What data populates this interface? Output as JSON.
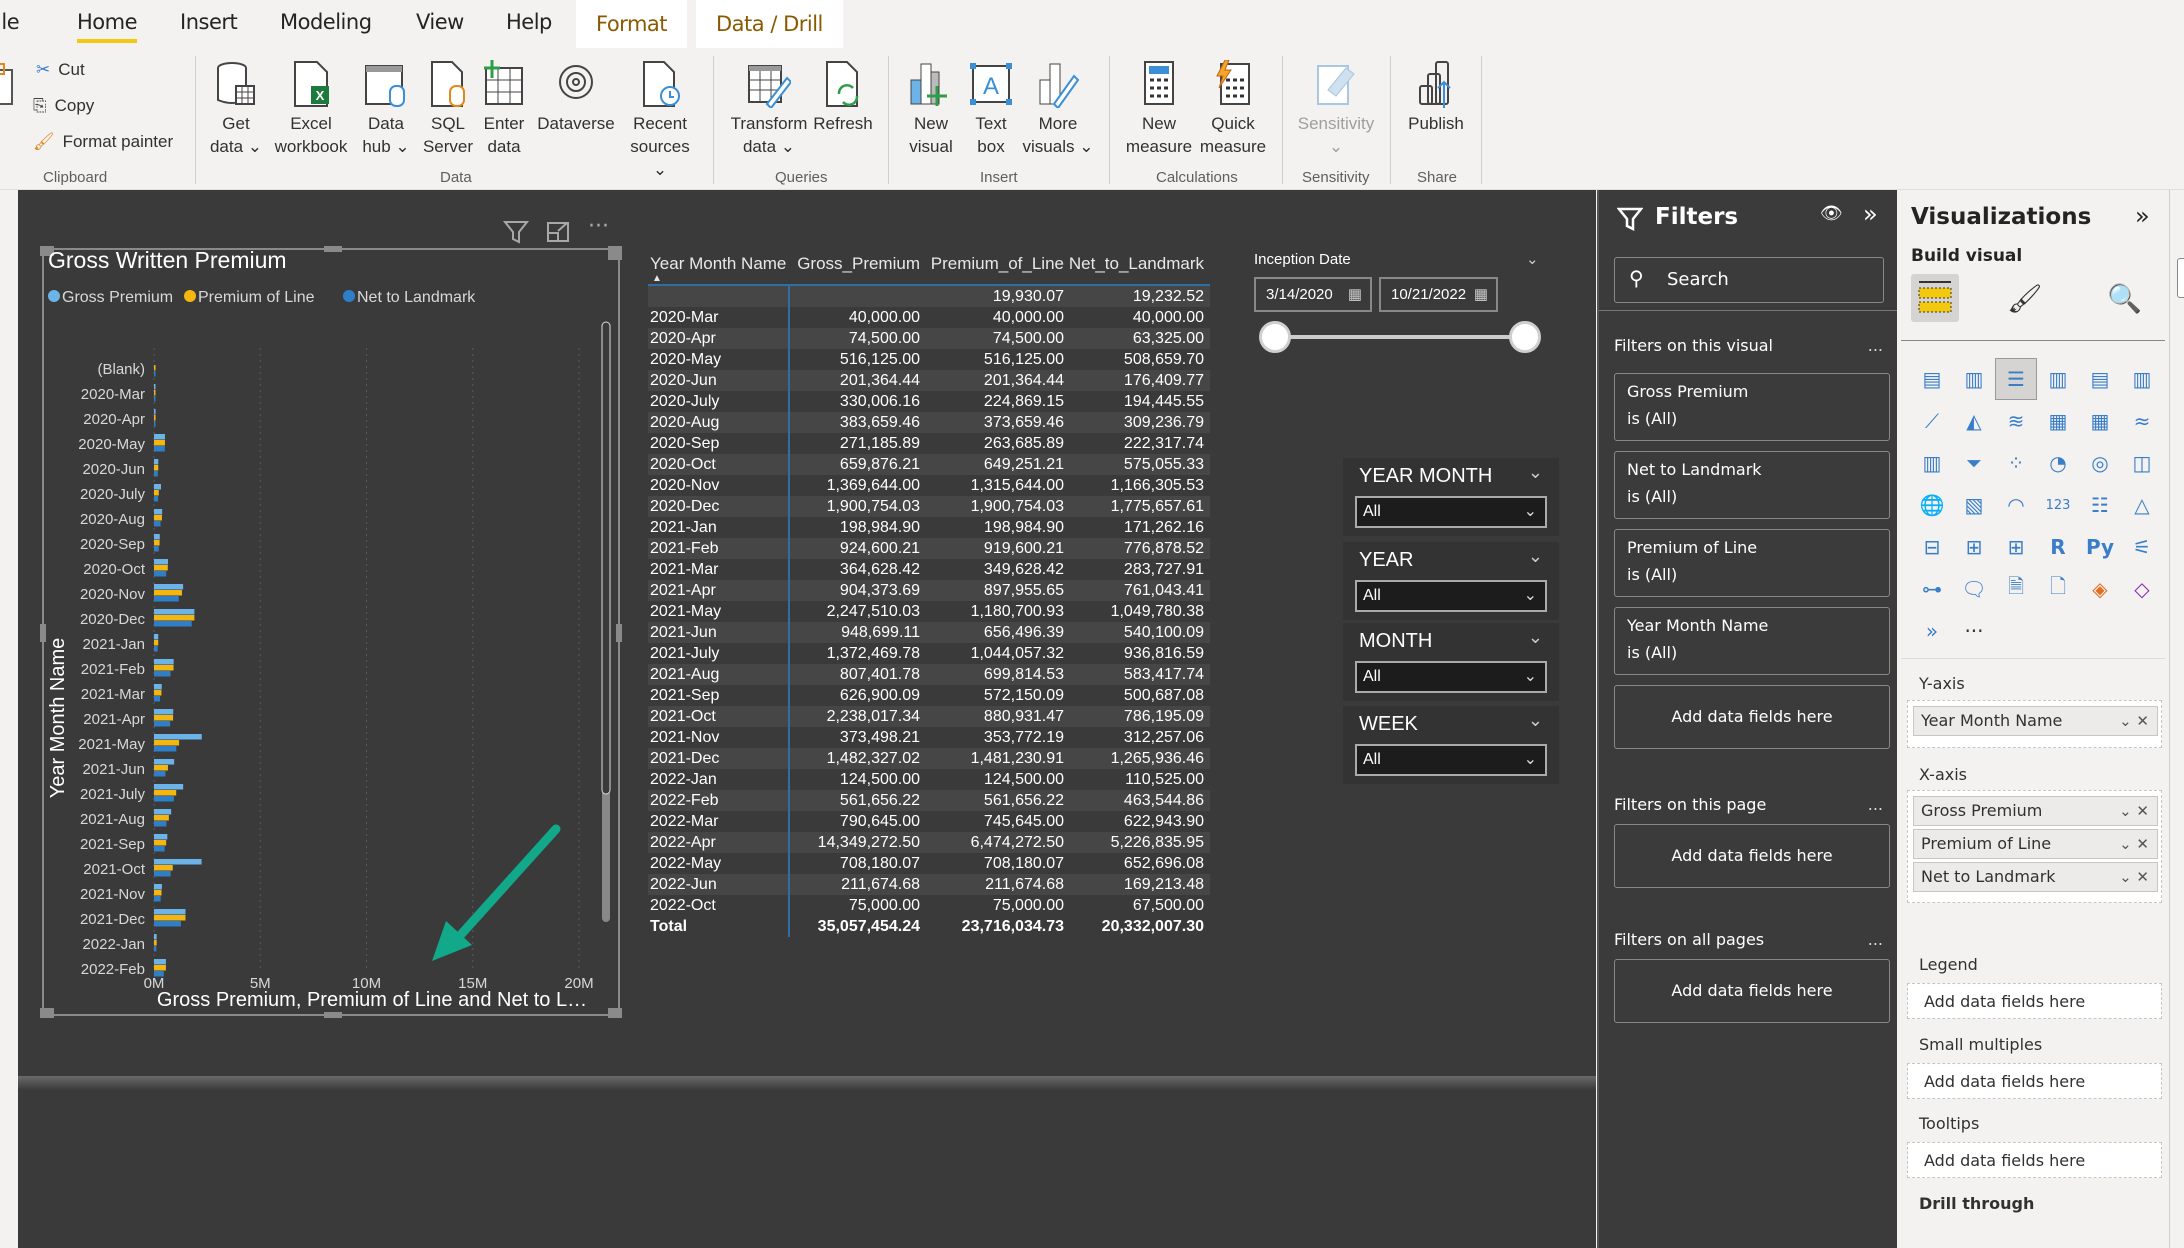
{
  "tabs": [
    {
      "label": "File"
    },
    {
      "label": "Home",
      "active": true
    },
    {
      "label": "Insert"
    },
    {
      "label": "Modeling"
    },
    {
      "label": "View"
    },
    {
      "label": "Help"
    },
    {
      "label": "Format",
      "contextual": true
    },
    {
      "label": "Data / Drill",
      "contextual": true
    }
  ],
  "ribbon": {
    "clipboard": {
      "paste": "Paste",
      "cut": "Cut",
      "copy": "Copy",
      "format_painter": "Format painter",
      "label": "Clipboard"
    },
    "data": {
      "label": "Data",
      "buttons": [
        {
          "l1": "Get",
          "l2": "data",
          "dropdown": true,
          "icon": "database-icon"
        },
        {
          "l1": "Excel",
          "l2": "workbook",
          "icon": "excel-icon"
        },
        {
          "l1": "Data",
          "l2": "hub",
          "dropdown": true,
          "icon": "data-hub-icon"
        },
        {
          "l1": "SQL",
          "l2": "Server",
          "icon": "sql-server-icon"
        },
        {
          "l1": "Enter",
          "l2": "data",
          "icon": "enter-data-icon"
        },
        {
          "l1": "Dataverse",
          "l2": "",
          "icon": "dataverse-icon"
        },
        {
          "l1": "Recent",
          "l2": "sources",
          "dropdown": true,
          "icon": "recent-sources-icon"
        }
      ]
    },
    "queries": {
      "label": "Queries",
      "transform_l1": "Transform",
      "transform_l2": "data",
      "refresh": "Refresh"
    },
    "insert": {
      "label": "Insert",
      "new_visual_l1": "New",
      "new_visual_l2": "visual",
      "text_box_l1": "Text",
      "text_box_l2": "box",
      "more_visuals_l1": "More",
      "more_visuals_l2": "visuals"
    },
    "calculations": {
      "label": "Calculations",
      "new_measure_l1": "New",
      "new_measure_l2": "measure",
      "quick_measure_l1": "Quick",
      "quick_measure_l2": "measure"
    },
    "sensitivity": {
      "label": "Sensitivity",
      "button": "Sensitivity"
    },
    "share": {
      "label": "Share",
      "publish": "Publish"
    }
  },
  "chart_data": {
    "type": "bar",
    "orientation": "horizontal",
    "title": "Gross Written Premium",
    "xlabel": "Gross Premium, Premium of Line and Net to L…",
    "ylabel": "Year Month Name",
    "xlim": [
      0,
      20000000
    ],
    "xticks": [
      "0M",
      "5M",
      "10M",
      "15M",
      "20M"
    ],
    "xtick_values": [
      0,
      5000000,
      10000000,
      15000000,
      20000000
    ],
    "grid": true,
    "legend_position": "top-left",
    "categories": [
      "(Blank)",
      "2020-Mar",
      "2020-Apr",
      "2020-May",
      "2020-Jun",
      "2020-July",
      "2020-Aug",
      "2020-Sep",
      "2020-Oct",
      "2020-Nov",
      "2020-Dec",
      "2021-Jan",
      "2021-Feb",
      "2021-Mar",
      "2021-Apr",
      "2021-May",
      "2021-Jun",
      "2021-July",
      "2021-Aug",
      "2021-Sep",
      "2021-Oct",
      "2021-Nov",
      "2021-Dec",
      "2022-Jan",
      "2022-Feb"
    ],
    "series": [
      {
        "name": "Gross Premium",
        "color": "#6cb4e8",
        "values": [
          0,
          40000.0,
          74500.0,
          516125.0,
          201364.44,
          330006.16,
          383659.46,
          271185.89,
          659876.21,
          1369644.0,
          1900754.03,
          198984.9,
          924600.21,
          364628.42,
          904373.69,
          2247510.03,
          948699.11,
          1372469.78,
          807401.78,
          626900.09,
          2238017.34,
          373498.21,
          1482327.02,
          124500.0,
          561656.22
        ]
      },
      {
        "name": "Premium of Line",
        "color": "#f5b60f",
        "values": [
          19930.07,
          40000.0,
          74500.0,
          516125.0,
          201364.44,
          224869.15,
          373659.46,
          263685.89,
          649251.21,
          1315644.0,
          1900754.03,
          198984.9,
          919600.21,
          349628.42,
          897955.65,
          1180700.93,
          656496.39,
          1044057.32,
          699814.53,
          572150.09,
          880931.47,
          353772.19,
          1481230.91,
          124500.0,
          561656.22
        ]
      },
      {
        "name": "Net to Landmark",
        "color": "#2f7fc8",
        "values": [
          19232.52,
          40000.0,
          63325.0,
          508659.7,
          176409.77,
          194445.55,
          309236.79,
          222317.74,
          575055.33,
          1166305.53,
          1775657.61,
          171262.16,
          776878.52,
          283727.91,
          761043.41,
          1049780.38,
          540100.09,
          936816.59,
          583417.74,
          500687.08,
          786195.09,
          312257.06,
          1265936.46,
          110525.0,
          463544.86
        ]
      }
    ]
  },
  "table": {
    "headers": [
      "Year Month Name",
      "Gross_Premium",
      "Premium_of_Line",
      "Net_to_Landmark"
    ],
    "sort_indicator": "▲",
    "rows": [
      [
        "",
        "",
        "19,930.07",
        "19,232.52"
      ],
      [
        "2020-Mar",
        "40,000.00",
        "40,000.00",
        "40,000.00"
      ],
      [
        "2020-Apr",
        "74,500.00",
        "74,500.00",
        "63,325.00"
      ],
      [
        "2020-May",
        "516,125.00",
        "516,125.00",
        "508,659.70"
      ],
      [
        "2020-Jun",
        "201,364.44",
        "201,364.44",
        "176,409.77"
      ],
      [
        "2020-July",
        "330,006.16",
        "224,869.15",
        "194,445.55"
      ],
      [
        "2020-Aug",
        "383,659.46",
        "373,659.46",
        "309,236.79"
      ],
      [
        "2020-Sep",
        "271,185.89",
        "263,685.89",
        "222,317.74"
      ],
      [
        "2020-Oct",
        "659,876.21",
        "649,251.21",
        "575,055.33"
      ],
      [
        "2020-Nov",
        "1,369,644.00",
        "1,315,644.00",
        "1,166,305.53"
      ],
      [
        "2020-Dec",
        "1,900,754.03",
        "1,900,754.03",
        "1,775,657.61"
      ],
      [
        "2021-Jan",
        "198,984.90",
        "198,984.90",
        "171,262.16"
      ],
      [
        "2021-Feb",
        "924,600.21",
        "919,600.21",
        "776,878.52"
      ],
      [
        "2021-Mar",
        "364,628.42",
        "349,628.42",
        "283,727.91"
      ],
      [
        "2021-Apr",
        "904,373.69",
        "897,955.65",
        "761,043.41"
      ],
      [
        "2021-May",
        "2,247,510.03",
        "1,180,700.93",
        "1,049,780.38"
      ],
      [
        "2021-Jun",
        "948,699.11",
        "656,496.39",
        "540,100.09"
      ],
      [
        "2021-July",
        "1,372,469.78",
        "1,044,057.32",
        "936,816.59"
      ],
      [
        "2021-Aug",
        "807,401.78",
        "699,814.53",
        "583,417.74"
      ],
      [
        "2021-Sep",
        "626,900.09",
        "572,150.09",
        "500,687.08"
      ],
      [
        "2021-Oct",
        "2,238,017.34",
        "880,931.47",
        "786,195.09"
      ],
      [
        "2021-Nov",
        "373,498.21",
        "353,772.19",
        "312,257.06"
      ],
      [
        "2021-Dec",
        "1,482,327.02",
        "1,481,230.91",
        "1,265,936.46"
      ],
      [
        "2022-Jan",
        "124,500.00",
        "124,500.00",
        "110,525.00"
      ],
      [
        "2022-Feb",
        "561,656.22",
        "561,656.22",
        "463,544.86"
      ],
      [
        "2022-Mar",
        "790,645.00",
        "745,645.00",
        "622,943.90"
      ],
      [
        "2022-Apr",
        "14,349,272.50",
        "6,474,272.50",
        "5,226,835.95"
      ],
      [
        "2022-May",
        "708,180.07",
        "708,180.07",
        "652,696.08"
      ],
      [
        "2022-Jun",
        "211,674.68",
        "211,674.68",
        "169,213.48"
      ],
      [
        "2022-Oct",
        "75,000.00",
        "75,000.00",
        "67,500.00"
      ]
    ],
    "total": [
      "Total",
      "35,057,454.24",
      "23,716,034.73",
      "20,332,007.30"
    ]
  },
  "date_slicer": {
    "title": "Inception Date",
    "start": "3/14/2020",
    "end": "10/21/2022",
    "range_start_fraction": 0,
    "range_end_fraction": 1
  },
  "slicers": [
    {
      "title": "YEAR MONTH",
      "value": "All"
    },
    {
      "title": "YEAR",
      "value": "All"
    },
    {
      "title": "MONTH",
      "value": "All"
    },
    {
      "title": "WEEK",
      "value": "All"
    }
  ],
  "filters": {
    "title": "Filters",
    "search_placeholder": "Search",
    "on_visual_label": "Filters on this visual",
    "visual_filters": [
      {
        "field": "Gross Premium",
        "state": "is (All)"
      },
      {
        "field": "Net to Landmark",
        "state": "is (All)"
      },
      {
        "field": "Premium of Line",
        "state": "is (All)"
      },
      {
        "field": "Year Month Name",
        "state": "is (All)"
      }
    ],
    "add_fields": "Add data fields here",
    "on_page_label": "Filters on this page",
    "on_all_label": "Filters on all pages",
    "more": "..."
  },
  "visualizations": {
    "title": "Visualizations",
    "build_visual": "Build visual",
    "y_axis_label": "Y-axis",
    "y_axis_fields": [
      "Year Month Name"
    ],
    "x_axis_label": "X-axis",
    "x_axis_fields": [
      "Gross Premium",
      "Premium of Line",
      "Net to Landmark"
    ],
    "legend_label": "Legend",
    "small_multiples_label": "Small multiples",
    "tooltips_label": "Tooltips",
    "drill_through_label": "Drill through",
    "add_fields": "Add data fields here",
    "more_visuals": "···"
  }
}
